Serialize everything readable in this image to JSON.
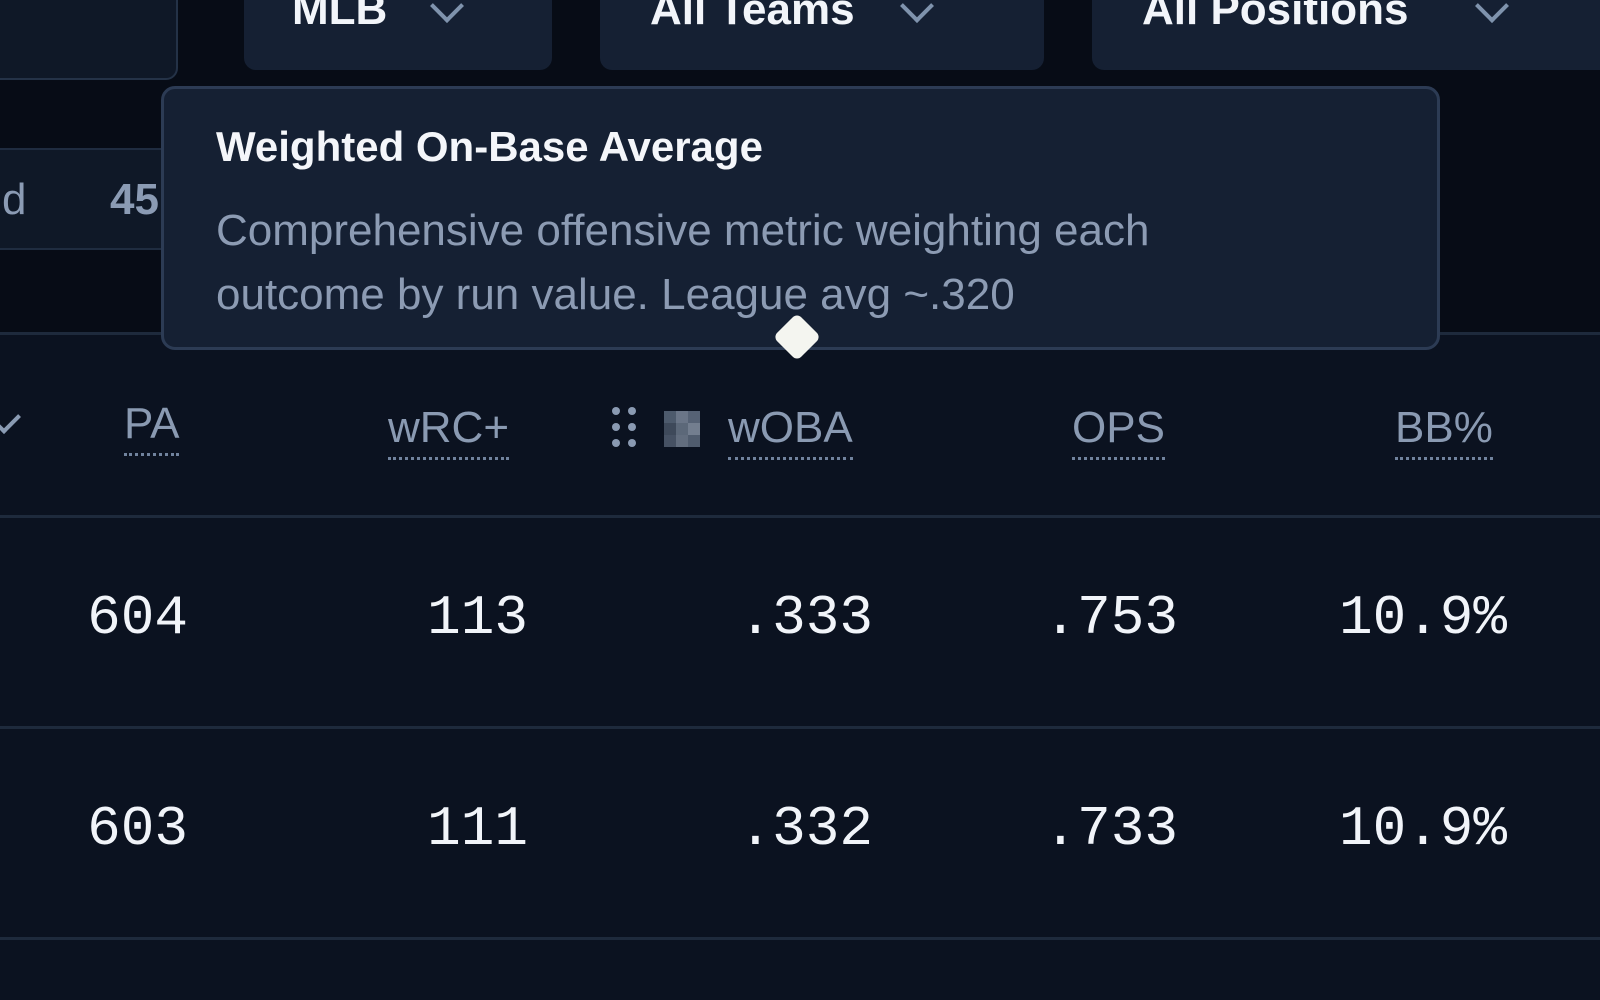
{
  "filters": {
    "league": "MLB",
    "teams": "All Teams",
    "positions": "All Positions"
  },
  "stat_pill": {
    "label": "d",
    "value": "45"
  },
  "tooltip": {
    "title": "Weighted On-Base Average",
    "body": "Comprehensive offensive metric weighting each outcome by run value. League avg ~.320"
  },
  "table": {
    "columns": {
      "pa": "PA",
      "wrc": "wRC+",
      "woba": "wOBA",
      "ops": "OPS",
      "bb": "BB%"
    },
    "rows": [
      {
        "pa": "604",
        "wrc": "113",
        "woba": ".333",
        "ops": ".753",
        "bb": "10.9%"
      },
      {
        "pa": "603",
        "wrc": "111",
        "woba": ".332",
        "ops": ".733",
        "bb": "10.9%"
      }
    ]
  },
  "icons": {
    "sort": "chevron-down-icon",
    "drag": "drag-handle-icon",
    "column": "column-heatmap-icon",
    "dropdown": "chevron-down-icon"
  }
}
